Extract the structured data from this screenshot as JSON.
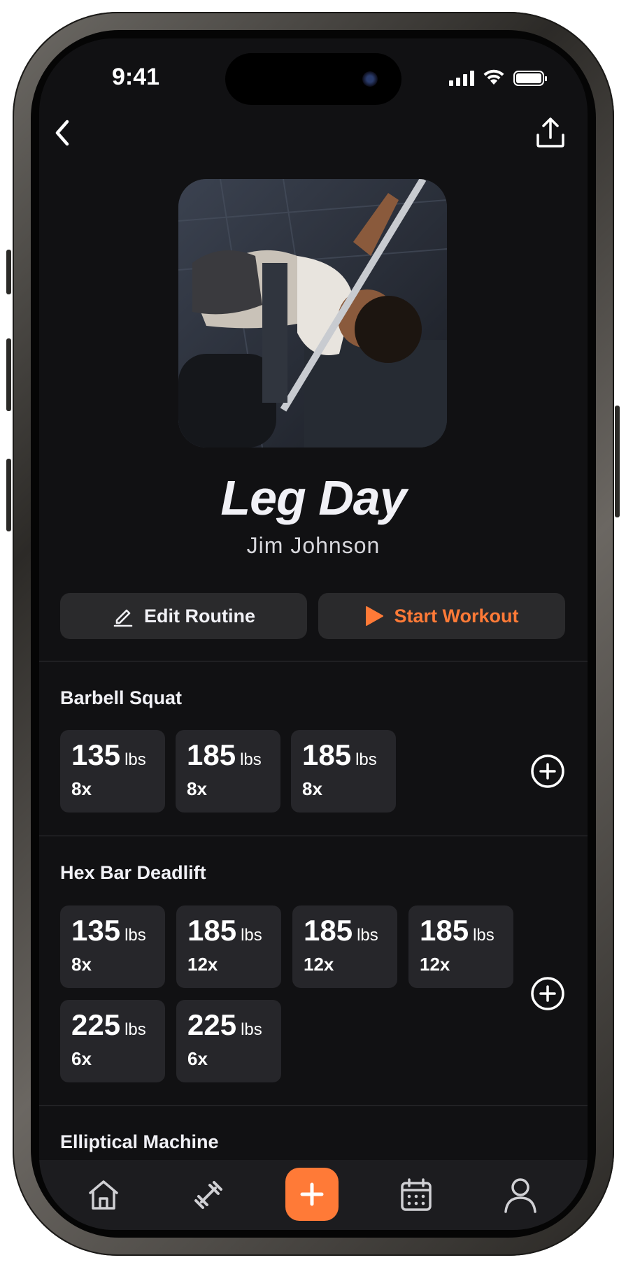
{
  "status_bar": {
    "time": "9:41"
  },
  "header": {
    "back_icon": "chevron-left-icon",
    "share_icon": "share-icon"
  },
  "routine": {
    "title": "Leg Day",
    "author": "Jim Johnson"
  },
  "actions": {
    "edit_label": "Edit Routine",
    "start_label": "Start Workout"
  },
  "colors": {
    "accent": "#ff7a37",
    "background": "#111113",
    "card": "#26262a"
  },
  "exercises": [
    {
      "name": "Barbell Squat",
      "sets": [
        {
          "weight": "135",
          "unit": "lbs",
          "reps": "8x"
        },
        {
          "weight": "185",
          "unit": "lbs",
          "reps": "8x"
        },
        {
          "weight": "185",
          "unit": "lbs",
          "reps": "8x"
        }
      ]
    },
    {
      "name": "Hex Bar Deadlift",
      "sets": [
        {
          "weight": "135",
          "unit": "lbs",
          "reps": "8x"
        },
        {
          "weight": "185",
          "unit": "lbs",
          "reps": "12x"
        },
        {
          "weight": "185",
          "unit": "lbs",
          "reps": "12x"
        },
        {
          "weight": "185",
          "unit": "lbs",
          "reps": "12x"
        },
        {
          "weight": "225",
          "unit": "lbs",
          "reps": "6x"
        },
        {
          "weight": "225",
          "unit": "lbs",
          "reps": "6x"
        }
      ]
    },
    {
      "name": "Elliptical Machine"
    }
  ],
  "tabbar": {
    "icons": [
      "home-icon",
      "dumbbell-icon",
      "plus-icon",
      "calendar-icon",
      "profile-icon"
    ]
  }
}
